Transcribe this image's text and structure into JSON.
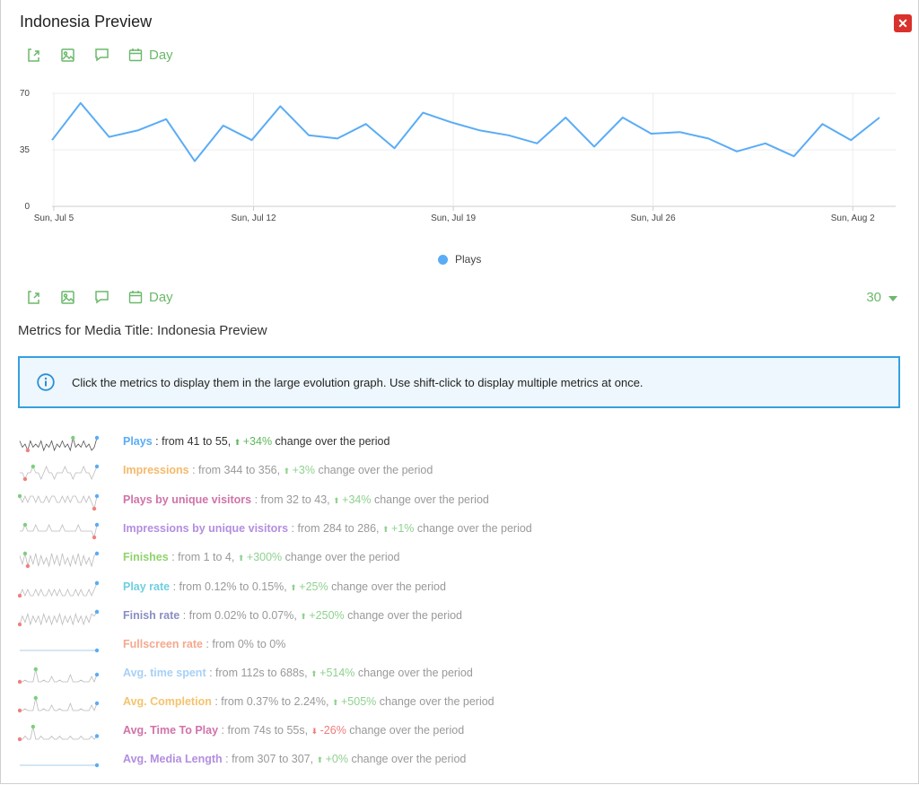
{
  "window": {
    "title": "Indonesia Preview",
    "close_label": "✕"
  },
  "toolbar": {
    "period_label": "Day"
  },
  "chart_data": {
    "type": "line",
    "title": "",
    "xlabel": "",
    "ylabel": "",
    "ylim": [
      0,
      70
    ],
    "yticks": [
      "0",
      "35",
      "70"
    ],
    "x_ticks": [
      "Sun, Jul 5",
      "Sun, Jul 12",
      "Sun, Jul 19",
      "Sun, Jul 26",
      "Sun, Aug 2"
    ],
    "x": [
      "Jul 5",
      "Jul 6",
      "Jul 7",
      "Jul 8",
      "Jul 9",
      "Jul 10",
      "Jul 11",
      "Jul 12",
      "Jul 13",
      "Jul 14",
      "Jul 15",
      "Jul 16",
      "Jul 17",
      "Jul 18",
      "Jul 19",
      "Jul 20",
      "Jul 21",
      "Jul 22",
      "Jul 23",
      "Jul 24",
      "Jul 25",
      "Jul 26",
      "Jul 27",
      "Jul 28",
      "Jul 29",
      "Jul 30",
      "Jul 31",
      "Aug 1",
      "Aug 2",
      "Aug 3"
    ],
    "series": [
      {
        "name": "Plays",
        "color": "#5aacf5",
        "values": [
          41,
          64,
          43,
          47,
          54,
          28,
          50,
          41,
          62,
          44,
          42,
          51,
          36,
          58,
          52,
          47,
          44,
          39,
          55,
          37,
          55,
          45,
          46,
          42,
          34,
          39,
          31,
          51,
          41,
          55
        ]
      }
    ],
    "grid": true,
    "legend": "bottom-center"
  },
  "period_select": {
    "value": "30"
  },
  "metrics_title": "Metrics for Media Title: Indonesia Preview",
  "info_text": "Click the metrics to display them in the large evolution graph. Use shift-click to display multiple metrics at once.",
  "metrics": [
    {
      "name": "Plays",
      "color": "#5aacf5",
      "detail": " : from 41 to 55, ",
      "change": "+34%",
      "change_color": "#5cb85c",
      "tail": " change over the period"
    },
    {
      "name": "Impressions",
      "color": "#f5b96a",
      "detail": " : from 344 to 356, ",
      "change": "+3%",
      "change_color": "#8fd18f",
      "tail": " change over the period"
    },
    {
      "name": "Plays by unique visitors",
      "color": "#d073a8",
      "detail": " : from 32 to 43, ",
      "change": "+34%",
      "change_color": "#8fd18f",
      "tail": " change over the period"
    },
    {
      "name": "Impressions by unique visitors",
      "color": "#b38ee0",
      "detail": " : from 284 to 286, ",
      "change": "+1%",
      "change_color": "#8fd18f",
      "tail": " change over the period"
    },
    {
      "name": "Finishes",
      "color": "#8fd36e",
      "detail": " : from 1 to 4, ",
      "change": "+300%",
      "change_color": "#8fd18f",
      "tail": " change over the period"
    },
    {
      "name": "Play rate",
      "color": "#6fcfe0",
      "detail": " : from 0.12% to 0.15%, ",
      "change": "+25%",
      "change_color": "#8fd18f",
      "tail": " change over the period"
    },
    {
      "name": "Finish rate",
      "color": "#8a8fc2",
      "detail": " : from 0.02% to 0.07%, ",
      "change": "+250%",
      "change_color": "#8fd18f",
      "tail": " change over the period"
    },
    {
      "name": "Fullscreen rate",
      "color": "#f5a98e",
      "detail": " : from 0% to 0%",
      "change": "",
      "change_color": "#8fd18f",
      "tail": ""
    },
    {
      "name": "Avg. time spent",
      "color": "#a8d0f5",
      "detail": " : from 112s to 688s, ",
      "change": "+514%",
      "change_color": "#8fd18f",
      "tail": " change over the period"
    },
    {
      "name": "Avg. Completion",
      "color": "#f5c36e",
      "detail": " : from 0.37% to 2.24%, ",
      "change": "+505%",
      "change_color": "#8fd18f",
      "tail": " change over the period"
    },
    {
      "name": "Avg. Time To Play",
      "color": "#d073a8",
      "detail": " : from 74s to 55s, ",
      "change": "-26%",
      "change_color": "#f07b7b",
      "tail": " change over the period"
    },
    {
      "name": "Avg. Media Length",
      "color": "#b38ee0",
      "detail": " : from 307 to 307, ",
      "change": "+0%",
      "change_color": "#8fd18f",
      "tail": " change over the period"
    }
  ]
}
